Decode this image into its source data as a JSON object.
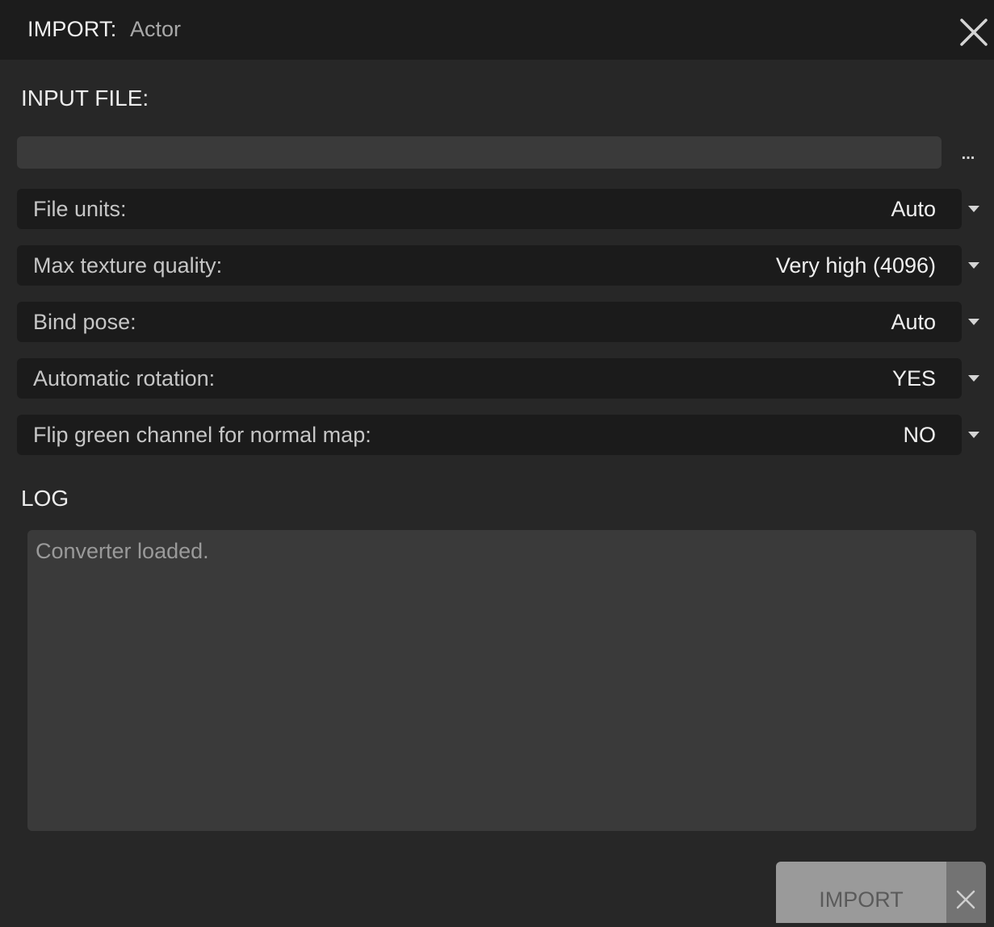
{
  "window": {
    "title": "IMPORT:",
    "subtitle": "Actor",
    "close_icon": "close-icon"
  },
  "input_file": {
    "heading": "INPUT FILE:",
    "value": "",
    "placeholder": "",
    "browse_label": "..."
  },
  "options": [
    {
      "label": "File units:",
      "value": "Auto"
    },
    {
      "label": "Max texture quality:",
      "value": "Very high (4096)"
    },
    {
      "label": "Bind pose:",
      "value": "Auto"
    },
    {
      "label": "Automatic rotation:",
      "value": "YES"
    },
    {
      "label": "Flip green channel for normal map:",
      "value": "NO"
    }
  ],
  "log": {
    "heading": "LOG",
    "lines": [
      "Converter loaded."
    ]
  },
  "footer": {
    "import_label": "IMPORT",
    "cancel_icon": "close-icon"
  },
  "colors": {
    "background": "#272727",
    "titlebar": "#1c1c1c",
    "row": "#1b1b1b",
    "field": "#3a3a3a",
    "import_button_disabled": "#9a9a9a"
  }
}
